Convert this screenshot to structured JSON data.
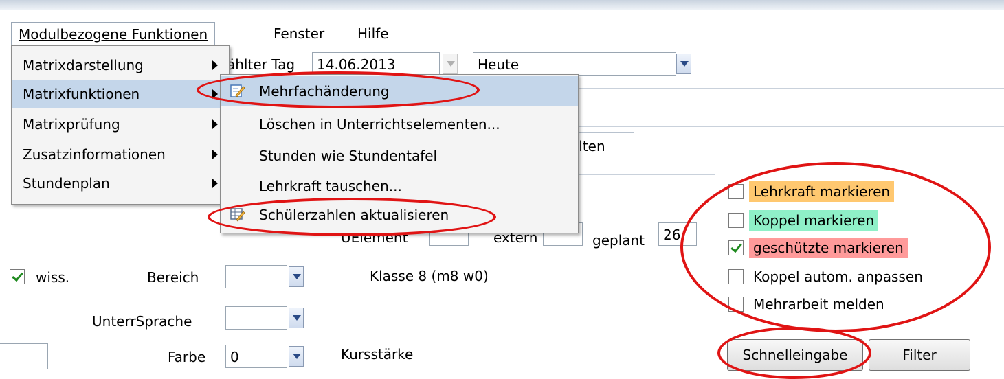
{
  "menubar": {
    "items": [
      {
        "label": "Modulbezogene Funktionen"
      },
      {
        "label": "Fenster"
      },
      {
        "label": "Hilfe"
      }
    ]
  },
  "toolbar": {
    "day_label": "ählter Tag",
    "day_value": "14.06.2013",
    "period_value": "Heute"
  },
  "menu_main": {
    "items": [
      {
        "label": "Matrixdarstellung"
      },
      {
        "label": "Matrixfunktionen"
      },
      {
        "label": "Matrixprüfung"
      },
      {
        "label": "Zusatzinformationen"
      },
      {
        "label": "Stundenplan"
      }
    ]
  },
  "menu_sub": {
    "items": [
      {
        "label": "Mehrfachänderung",
        "icon": "edit-pencil-icon"
      },
      {
        "label": "Löschen in Unterrichtselementen..."
      },
      {
        "label": "Stunden wie Stundentafel"
      },
      {
        "label": "Lehrkraft tauschen..."
      },
      {
        "label": "Schülerzahlen aktualisieren",
        "icon": "table-pencil-icon"
      }
    ]
  },
  "tab": {
    "label": "alten"
  },
  "form": {
    "uelement_label": "UElement",
    "extern_label": "extern",
    "geplant_label": "geplant",
    "geplant_value": "26",
    "wiss_label": "wiss.",
    "bereich_label": "Bereich",
    "klasse_text": "Klasse  8 (m8 w0)",
    "unterrsprache_label": "UnterrSprache",
    "farbe_label": "Farbe",
    "farbe_value": "0",
    "kursstaerke_label": "Kursstärke"
  },
  "options": [
    {
      "label": "Lehrkraft markieren",
      "checked": false,
      "bg": "#ffc870"
    },
    {
      "label": "Koppel markieren",
      "checked": false,
      "bg": "#8ff0c8"
    },
    {
      "label": "geschützte markieren",
      "checked": true,
      "bg": "#ff9a9a"
    },
    {
      "label": "Koppel autom. anpassen",
      "checked": false,
      "bg": ""
    },
    {
      "label": "Mehrarbeit melden",
      "checked": false,
      "bg": ""
    }
  ],
  "buttons": {
    "schnelleingabe": "Schnelleingabe",
    "filter": "Filter"
  },
  "colors": {
    "annotation": "#e01414",
    "highlight": "#c4d6ea"
  }
}
